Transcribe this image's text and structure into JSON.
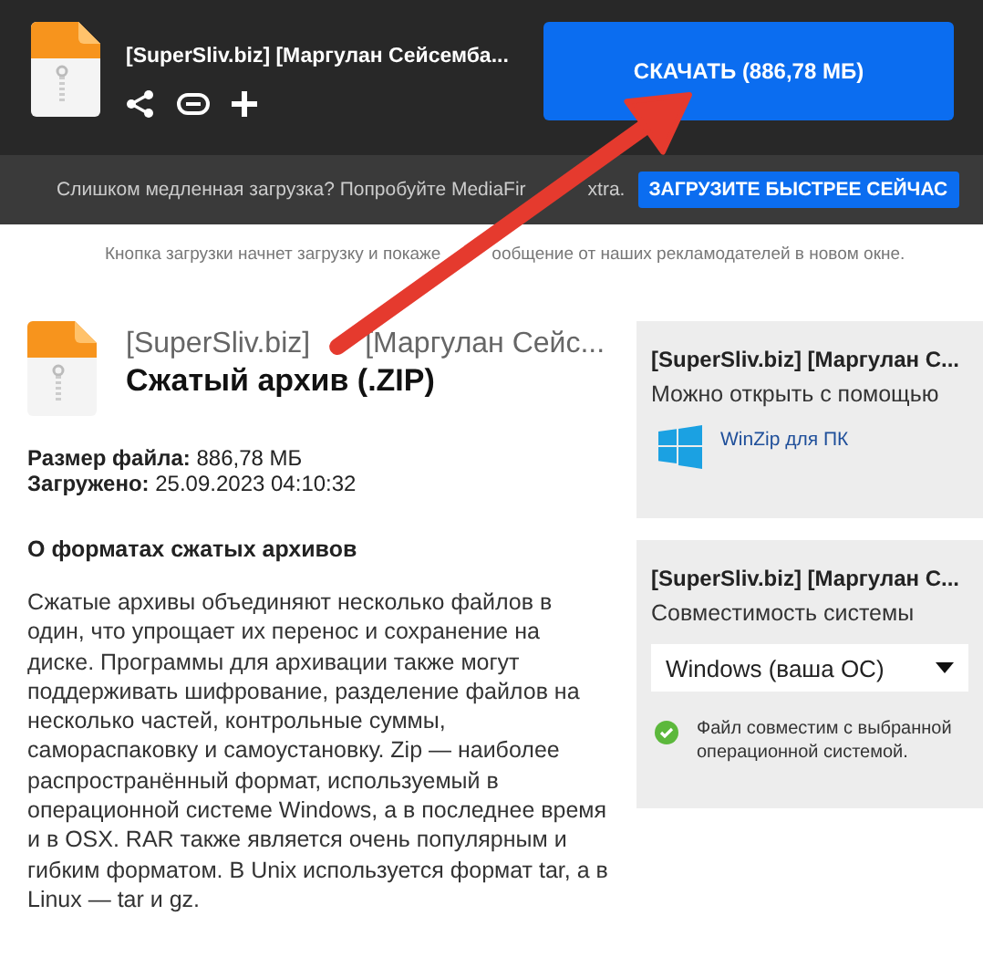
{
  "header": {
    "file_name": "[SuperSliv.biz] [Маргулан Сейсемба...",
    "download_button": "СКАЧАТЬ (886,78 МБ)"
  },
  "promo": {
    "text": [
      "Слишком медленная загрузка? Попробуйте MediaFir",
      "xtra."
    ],
    "button": "ЗАГРУЗИТЕ БЫСТРЕЕ СЕЙЧАС"
  },
  "notice": [
    "Кнопка загрузки начнет загрузку и покаже",
    "ообщение от наших рекламодателей в новом окне."
  ],
  "file": {
    "name": [
      "[SuperSliv.biz]",
      "[Маргулан Сейс..."
    ],
    "type": "Сжатый архив (.ZIP)",
    "details": [
      {
        "label": "Размер файла:",
        "value": "886,78 МБ"
      },
      {
        "label": "Загружено:",
        "value": "25.09.2023 04:10:32"
      }
    ]
  },
  "about": {
    "title": "О форматах сжатых архивов",
    "text": "Сжатые архивы объединяют несколько файлов в один, что упрощает их перенос и сохранение на диске. Программы для архивации также могут поддерживать шифрование, разделение файлов на несколько частей, контрольные суммы, самораспаковку и самоустановку. Zip — наиболее распространённый формат, используемый в операционной системе Windows, а в последнее время и в OSX. RAR также является очень популярным и гибким форматом. В Unix используется формат tar, а в Linux — tar и gz."
  },
  "panels": [
    {
      "kind": "apps",
      "title": "[SuperSliv.biz] [Маргулан С...",
      "subtitle": "Можно открыть с помощью",
      "apps": [
        "WinZip для ПК"
      ]
    },
    {
      "kind": "compat",
      "title": "[SuperSliv.biz] [Маргулан С...",
      "subtitle": "Совместимость системы",
      "select": "Windows (ваша ОС)",
      "status": "Файл совместим с выбранной операционной системой."
    }
  ]
}
